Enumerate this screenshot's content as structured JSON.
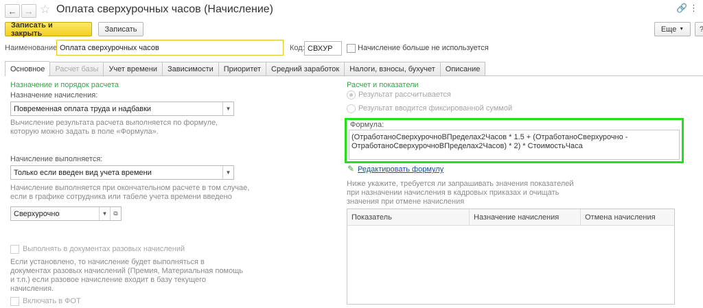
{
  "window": {
    "title": "Оплата сверхурочных часов (Начисление)"
  },
  "toolbar": {
    "save_close": "Записать и закрыть",
    "save": "Записать",
    "more": "Еще",
    "help": "?"
  },
  "header": {
    "name_label": "Наименование:",
    "name_value": "Оплата сверхурочных часов",
    "code_label": "Код:",
    "code_value": "СВХУР",
    "unused_label": "Начисление больше не используется"
  },
  "tabs": [
    {
      "label": "Основное"
    },
    {
      "label": "Расчет базы"
    },
    {
      "label": "Учет времени"
    },
    {
      "label": "Зависимости"
    },
    {
      "label": "Приоритет"
    },
    {
      "label": "Средний заработок"
    },
    {
      "label": "Налоги, взносы, бухучет"
    },
    {
      "label": "Описание"
    }
  ],
  "left": {
    "section_title": "Назначение и порядок расчета",
    "purpose_label": "Назначение начисления:",
    "purpose_value": "Повременная оплата труда и надбавки",
    "purpose_hint_1": "Вычисление результата расчета выполняется по формуле,",
    "purpose_hint_2": "которую можно задать в поле «Формула».",
    "performed_label": "Начисление выполняется:",
    "performed_value": "Только если введен вид учета времени",
    "performed_hint_1": "Начисление выполняется при окончательном расчете в том случае,",
    "performed_hint_2": "если в графике сотрудника или табеле учета времени введено",
    "time_type_value": "Сверхурочно",
    "onetime_label": "Выполнять в документах разовых начислений",
    "onetime_hint_1": "Если установлено, то начисление будет выполняться в",
    "onetime_hint_2": "документах разовых начислений (Премия, Материальная помощь",
    "onetime_hint_3": "и т.п.) если разовое начисление входит в базу текущего",
    "onetime_hint_4": "начисления.",
    "fot_label": "Включать в ФОТ"
  },
  "right": {
    "section_title": "Расчет и показатели",
    "radio_calc": "Результат рассчитывается",
    "radio_fixed": "Результат вводится фиксированной суммой",
    "formula_label": "Формула:",
    "formula_line_1": "(ОтработаноСверхурочноВПределах2Часов * 1.5 + (ОтработаноСверхурочно -",
    "formula_line_2": "ОтработаноСверхурочноВПределах2Часов) * 2) * СтоимостьЧаса",
    "edit_formula": "Редактировать формулу",
    "indicators_hint_1": "Ниже укажите, требуется ли запрашивать значения показателей",
    "indicators_hint_2": "при назначении начисления в кадровых приказах и очищать",
    "indicators_hint_3": "значения при отмене начисления",
    "table_headers": [
      "Показатель",
      "Назначение начисления",
      "Отмена начисления"
    ]
  },
  "colors": {
    "accent_green": "#3aa14a",
    "highlight": "#23e01a",
    "primary_button": "#f3cf20",
    "link": "#1a4f9c"
  }
}
